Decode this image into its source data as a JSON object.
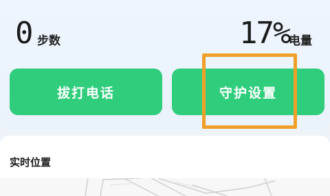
{
  "stats": {
    "steps_value": "0",
    "steps_label": "步数",
    "battery_value": "17%",
    "battery_label": "电量"
  },
  "actions": {
    "call_label": "拔打电话",
    "guard_label": "守护设置"
  },
  "location": {
    "title": "实时位置"
  },
  "colors": {
    "button_green": "#2fcd7c",
    "highlight_orange": "#f0a028",
    "card_bg": "#eef5ff"
  },
  "icons": []
}
